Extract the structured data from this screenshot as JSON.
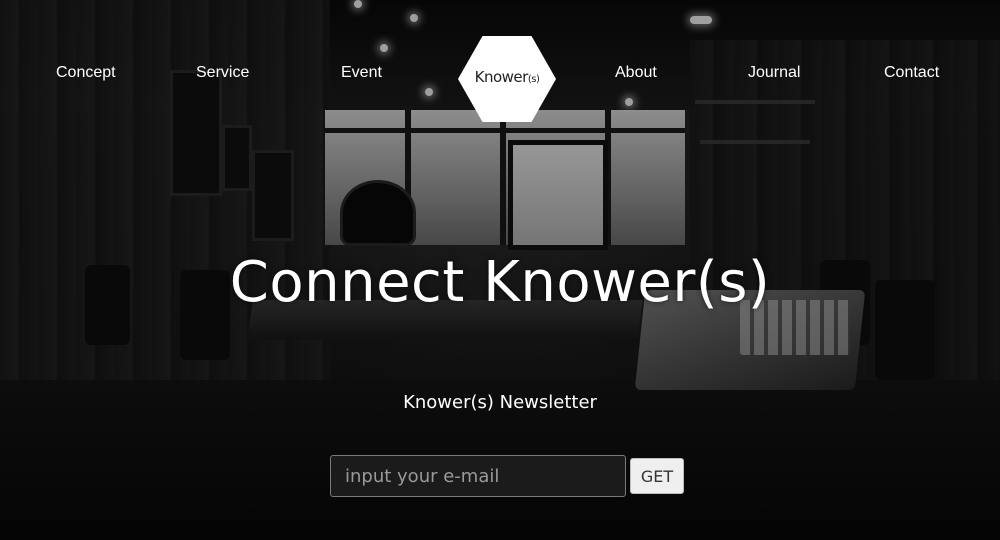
{
  "nav": {
    "items": [
      {
        "label": "Concept"
      },
      {
        "label": "Service"
      },
      {
        "label": "Event"
      },
      {
        "label": "About"
      },
      {
        "label": "Journal"
      },
      {
        "label": "Contact"
      }
    ],
    "logo": {
      "main": "Knower",
      "suffix": "(s)"
    }
  },
  "hero": {
    "headline": "Connect Knower(s)",
    "newsletter_label": "Knower(s) Newsletter",
    "email_placeholder": "input your e-mail",
    "email_value": "",
    "submit_label": "GET"
  },
  "colors": {
    "text": "#ffffff",
    "logo_bg": "#ffffff",
    "button_bg": "#efefef"
  }
}
